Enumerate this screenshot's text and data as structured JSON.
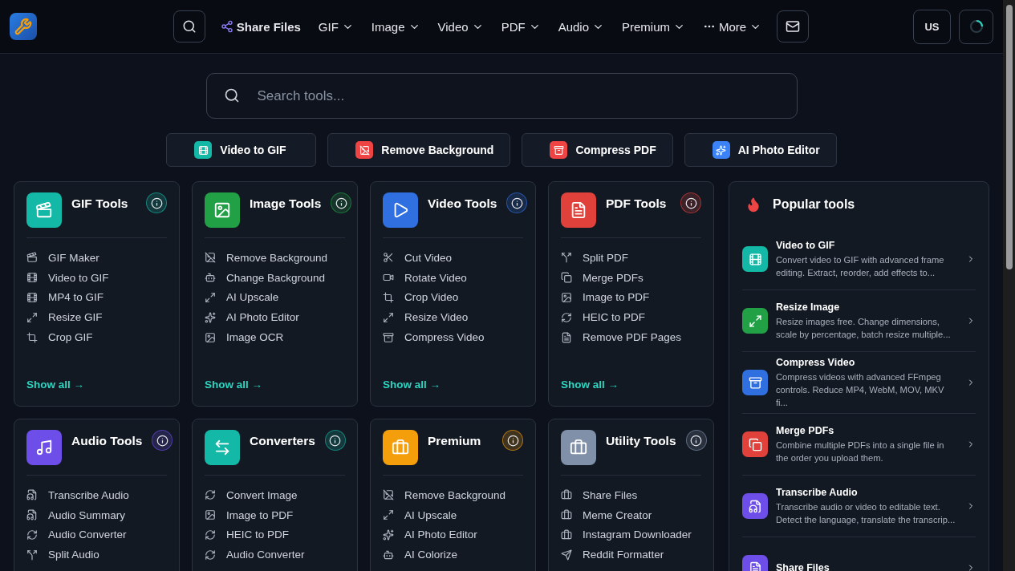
{
  "header": {
    "nav": [
      {
        "label": "Share Files",
        "kind": "link"
      },
      {
        "label": "GIF",
        "kind": "dropdown"
      },
      {
        "label": "Image",
        "kind": "dropdown"
      },
      {
        "label": "Video",
        "kind": "dropdown"
      },
      {
        "label": "PDF",
        "kind": "dropdown"
      },
      {
        "label": "Audio",
        "kind": "dropdown"
      },
      {
        "label": "Premium",
        "kind": "dropdown"
      },
      {
        "label": "More",
        "kind": "more"
      }
    ],
    "region_button": "US"
  },
  "search": {
    "placeholder": "Search tools..."
  },
  "quick_actions": [
    {
      "label": "Video to GIF",
      "color": "#14b8a6"
    },
    {
      "label": "Remove Background",
      "color": "#ef4444"
    },
    {
      "label": "Compress PDF",
      "color": "#ef4444"
    },
    {
      "label": "AI Photo Editor",
      "color": "#3b82f6"
    }
  ],
  "categories": [
    {
      "title": "GIF Tools",
      "color": "#14b8a6",
      "items": [
        "GIF Maker",
        "Video to GIF",
        "MP4 to GIF",
        "Resize GIF",
        "Crop GIF"
      ],
      "show_all": "Show all →"
    },
    {
      "title": "Image Tools",
      "color": "#22a045",
      "items": [
        "Remove Background",
        "Change Background",
        "AI Upscale",
        "AI Photo Editor",
        "Image OCR"
      ],
      "show_all": "Show all →"
    },
    {
      "title": "Video Tools",
      "color": "#2f6fe0",
      "items": [
        "Cut Video",
        "Rotate Video",
        "Crop Video",
        "Resize Video",
        "Compress Video"
      ],
      "show_all": "Show all →"
    },
    {
      "title": "PDF Tools",
      "color": "#e0413a",
      "items": [
        "Split PDF",
        "Merge PDFs",
        "Image to PDF",
        "HEIC to PDF",
        "Remove PDF Pages"
      ],
      "show_all": "Show all →"
    },
    {
      "title": "Audio Tools",
      "color": "#6d4ee8",
      "items": [
        "Transcribe Audio",
        "Audio Summary",
        "Audio Converter",
        "Split Audio"
      ]
    },
    {
      "title": "Converters",
      "color": "#14b8a6",
      "items": [
        "Convert Image",
        "Image to PDF",
        "HEIC to PDF",
        "Audio Converter"
      ]
    },
    {
      "title": "Premium",
      "color": "#f59e0b",
      "items": [
        "Remove Background",
        "AI Upscale",
        "AI Photo Editor",
        "AI Colorize"
      ]
    },
    {
      "title": "Utility Tools",
      "color": "#8090a8",
      "items": [
        "Share Files",
        "Meme Creator",
        "Instagram Downloader",
        "Reddit Formatter"
      ]
    }
  ],
  "popular": {
    "title": "Popular tools",
    "items": [
      {
        "title": "Video to GIF",
        "description": "Convert video to GIF with advanced frame editing. Extract, reorder, add effects to...",
        "color": "#14b8a6"
      },
      {
        "title": "Resize Image",
        "description": "Resize images free. Change dimensions, scale by percentage, batch resize multiple...",
        "color": "#22a045"
      },
      {
        "title": "Compress Video",
        "description": "Compress videos with advanced FFmpeg controls. Reduce MP4, WebM, MOV, MKV fi...",
        "color": "#2f6fe0"
      },
      {
        "title": "Merge PDFs",
        "description": "Combine multiple PDFs into a single file in the order you upload them.",
        "color": "#e0413a"
      },
      {
        "title": "Transcribe Audio",
        "description": "Transcribe audio or video to editable text. Detect the language, translate the transcrip...",
        "color": "#6d4ee8"
      },
      {
        "title": "Share Files",
        "color": "#6d4ee8"
      }
    ]
  }
}
